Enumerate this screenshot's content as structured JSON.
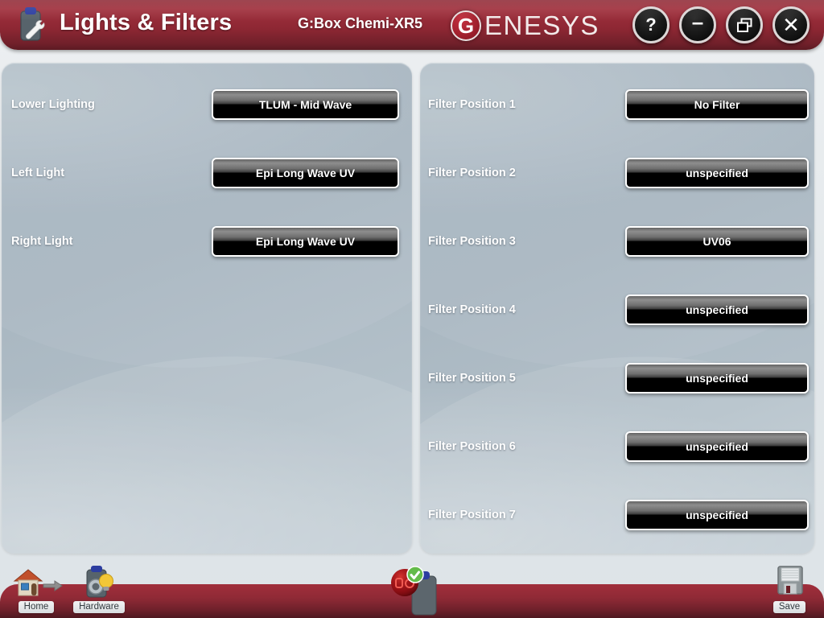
{
  "titlebar": {
    "icon": "hardware-wrench-icon",
    "title": "Lights & Filters",
    "device_name": "G:Box Chemi-XR5",
    "brand_mark": "G",
    "brand_rest": "ENESYS",
    "brand_color": "#9e1f2c",
    "accent_color": "#8e2733",
    "buttons": [
      {
        "name": "help-button",
        "glyph": "?"
      },
      {
        "name": "minimize-button",
        "glyph": "–"
      },
      {
        "name": "restore-button",
        "glyph": "restore-windows-icon"
      },
      {
        "name": "close-button",
        "glyph": "✕"
      }
    ]
  },
  "left_panel": {
    "rows": [
      {
        "label": "Lower Lighting",
        "value": "TLUM - Mid Wave"
      },
      {
        "label": "Left Light",
        "value": "Epi Long Wave UV"
      },
      {
        "label": "Right Light",
        "value": "Epi Long Wave UV"
      }
    ]
  },
  "right_panel": {
    "rows": [
      {
        "label": "Filter Position 1",
        "value": "No Filter"
      },
      {
        "label": "Filter Position 2",
        "value": "unspecified"
      },
      {
        "label": "Filter Position 3",
        "value": "UV06"
      },
      {
        "label": "Filter Position 4",
        "value": "unspecified"
      },
      {
        "label": "Filter Position 5",
        "value": "unspecified"
      },
      {
        "label": "Filter Position 6",
        "value": "unspecified"
      },
      {
        "label": "Filter Position 7",
        "value": "unspecified"
      }
    ]
  },
  "bottombar": {
    "home_label": "Home",
    "hardware_label": "Hardware",
    "save_label": "Save",
    "status_icon": "device-connected-ok-icon",
    "bar_color": "#902a36"
  }
}
